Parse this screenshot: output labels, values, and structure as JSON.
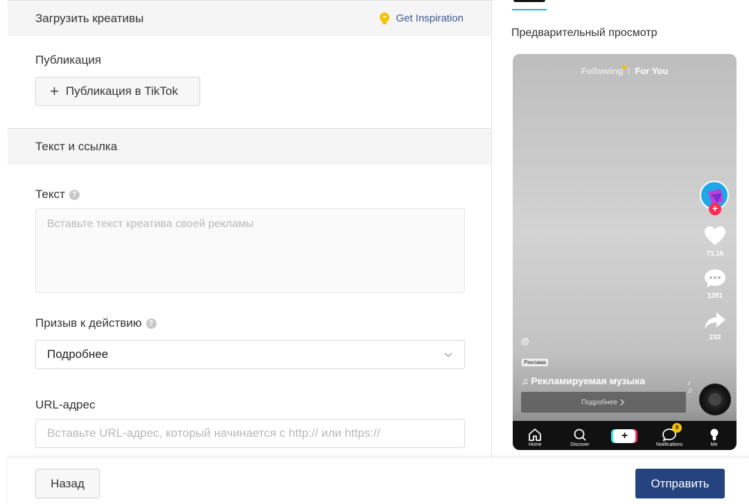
{
  "upload_section": {
    "title": "Загрузить креативы",
    "inspiration": "Get Inspiration"
  },
  "publication": {
    "label": "Публикация",
    "button": "Публикация в TikTok"
  },
  "text_link_section": {
    "title": "Текст и ссылка"
  },
  "text_field": {
    "label": "Текст",
    "placeholder": "Вставьте текст креатива своей рекламы"
  },
  "cta_field": {
    "label": "Призыв к действию",
    "value": "Подробнее"
  },
  "url_field": {
    "label": "URL-адрес",
    "placeholder": "Вставьте URL-адрес, который начинается с http:// или https://"
  },
  "footer": {
    "back": "Назад",
    "submit": "Отправить"
  },
  "preview": {
    "title": "Предварительный просмотр",
    "following": "Following",
    "for_you": "For You",
    "likes": "71.1k",
    "comments": "1281",
    "shares": "232",
    "at": "@",
    "ad_tag": "Реклама",
    "music": "♫ Рекламируемая музыка",
    "cta": "Подробнее",
    "nav": {
      "home": "Home",
      "discover": "Discover",
      "notifications": "Notifications",
      "me": "Me",
      "badge": "9"
    }
  },
  "colors": {
    "primary": "#25437f",
    "accent": "#20b2c8",
    "link": "#3b5998",
    "tiktok_red": "#fe2c55",
    "tiktok_cyan": "#25f4ee"
  }
}
